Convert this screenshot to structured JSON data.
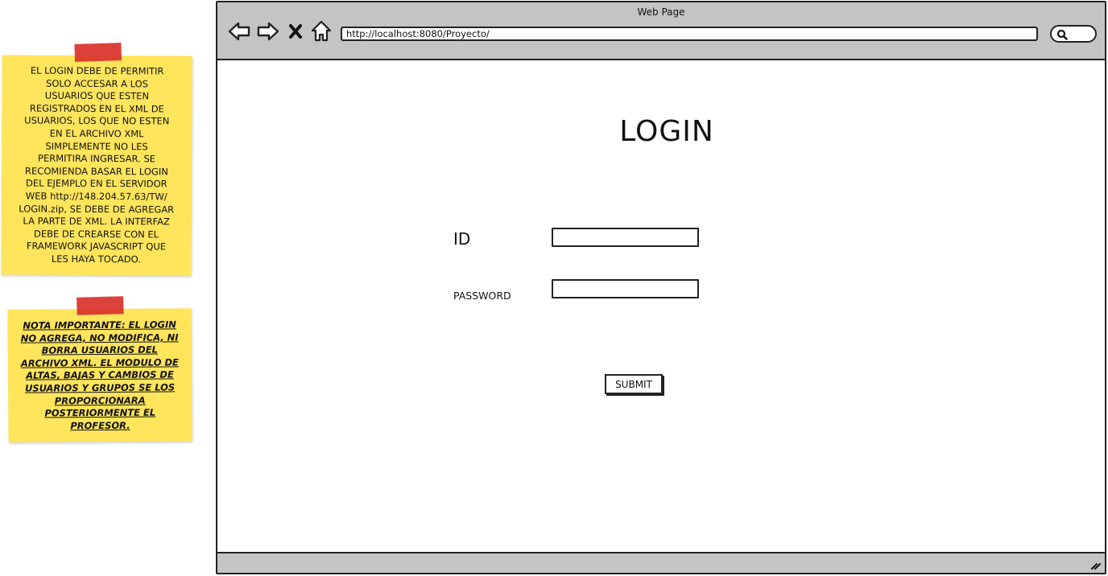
{
  "notes": [
    {
      "text": "EL LOGIN DEBE DE PERMITIR\nSOLO ACCESAR A LOS\nUSUARIOS QUE ESTEN\nREGISTRADOS EN EL XML DE\nUSUARIOS, LOS QUE NO ESTEN\nEN EL ARCHIVO XML\nSIMPLEMENTE NO LES\nPERMITIRA INGRESAR. SE\nRECOMIENDA BASAR EL LOGIN\nDEL EJEMPLO EN EL SERVIDOR\nWEB http://148.204.57.63/TW/\nLOGIN.zip, SE DEBE DE AGREGAR\nLA PARTE DE XML. LA INTERFAZ\nDEBE DE CREARSE CON EL\nFRAMEWORK JAVASCRIPT QUE\nLES HAYA TOCADO."
    },
    {
      "text": "NOTA IMPORTANTE: EL LOGIN\nNO AGREGA, NO MODIFICA, NI\nBORRA USUARIOS DEL\nARCHIVO XML. EL MODULO DE\nALTAS, BAJAS Y CAMBIOS DE\nUSUARIOS Y GRUPOS SE LOS\nPROPORCIONARA\nPOSTERIORMENTE EL\nPROFESOR."
    }
  ],
  "browser": {
    "title": "Web Page",
    "url": "http://localhost:8080/Proyecto/",
    "nav_icons": [
      "back-arrow-icon",
      "forward-arrow-icon",
      "close-icon",
      "home-icon"
    ],
    "search_icon": "search-icon"
  },
  "login": {
    "title": "LOGIN",
    "id_label": "ID",
    "id_value": "",
    "password_label": "PASSWORD",
    "password_value": "",
    "submit_label": "SUBMIT"
  },
  "colors": {
    "sticky_note": "#ffe55c",
    "tape": "#d9322a",
    "chrome_gray": "#c4c4c4",
    "outline": "#222222"
  }
}
